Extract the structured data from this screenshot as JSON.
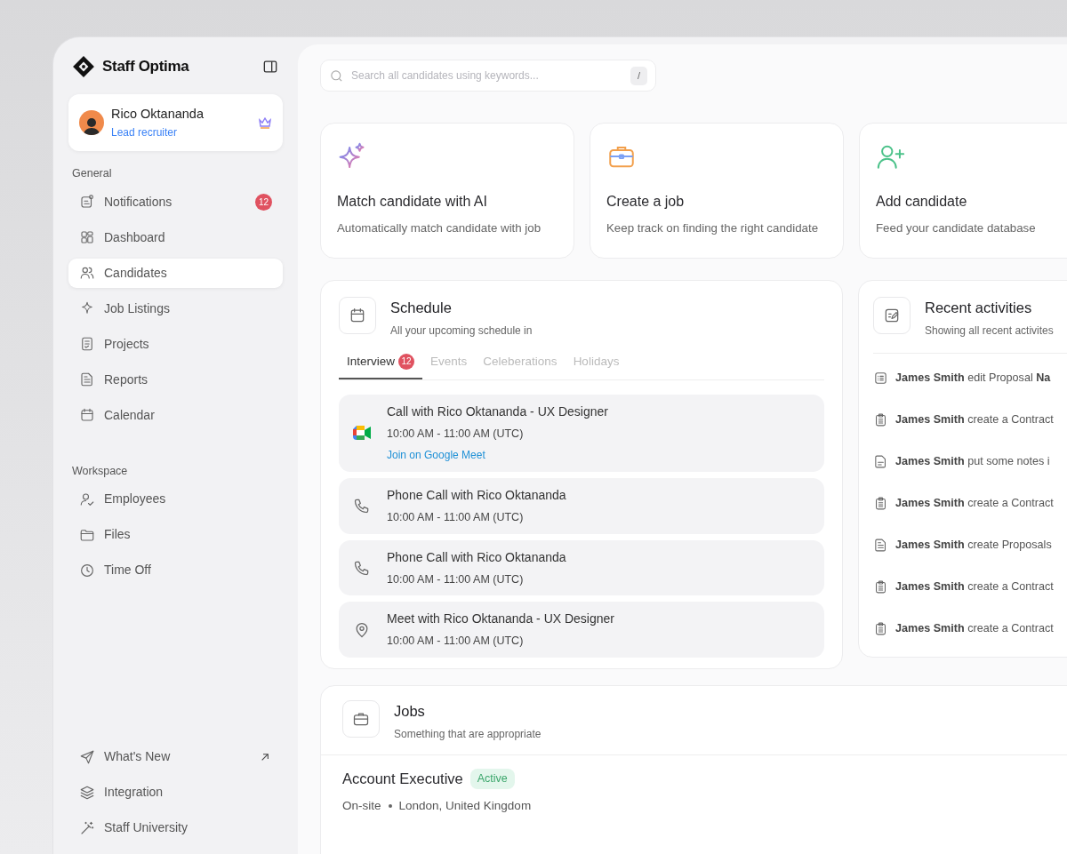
{
  "app": {
    "name": "Staff Optima"
  },
  "user": {
    "name": "Rico Oktananda",
    "role": "Lead recruiter"
  },
  "sidebar": {
    "sections": [
      {
        "title": "General",
        "items": [
          {
            "label": "Notifications",
            "kind": "notification",
            "badge": "12",
            "selected": false
          },
          {
            "label": "Dashboard",
            "kind": "grid",
            "selected": false
          },
          {
            "label": "Candidates",
            "kind": "users",
            "selected": true
          },
          {
            "label": "Job Listings",
            "kind": "sparkle",
            "selected": false
          },
          {
            "label": "Projects",
            "kind": "checklist",
            "selected": false
          },
          {
            "label": "Reports",
            "kind": "document",
            "selected": false
          },
          {
            "label": "Calendar",
            "kind": "calendar",
            "selected": false
          }
        ]
      },
      {
        "title": "Workspace",
        "items": [
          {
            "label": "Employees",
            "kind": "user-check",
            "selected": false
          },
          {
            "label": "Files",
            "kind": "folder",
            "selected": false
          },
          {
            "label": "Time Off",
            "kind": "clock",
            "selected": false
          }
        ]
      }
    ],
    "footer_items": [
      {
        "label": "What's New",
        "kind": "send",
        "external": true
      },
      {
        "label": "Integration",
        "kind": "layers",
        "external": false
      },
      {
        "label": "Staff University",
        "kind": "wand",
        "external": false
      }
    ]
  },
  "search": {
    "placeholder": "Search all candidates using keywords...",
    "shortcut": "/"
  },
  "quick_actions": [
    {
      "kind": "ai",
      "title": "Match candidate with AI",
      "description": "Automatically match candidate with job"
    },
    {
      "kind": "briefcase",
      "title": "Create a job",
      "description": "Keep track on finding the right candidate"
    },
    {
      "kind": "user-plus",
      "title": "Add candidate",
      "description": "Feed your candidate database"
    }
  ],
  "schedule": {
    "title": "Schedule",
    "subtitle": "All your upcoming schedule in",
    "tabs": [
      {
        "label": "Interview",
        "badge": "12",
        "selected": true
      },
      {
        "label": "Events",
        "selected": false
      },
      {
        "label": "Celeberations",
        "selected": false
      },
      {
        "label": "Holidays",
        "selected": false
      }
    ],
    "events": [
      {
        "kind": "video",
        "title": "Call with Rico Oktananda - UX Designer",
        "time": "10:00 AM - 11:00 AM (UTC)",
        "link": "Join on Google Meet"
      },
      {
        "kind": "phone",
        "title": "Phone Call with Rico Oktananda",
        "time": "10:00 AM - 11:00 AM (UTC)"
      },
      {
        "kind": "phone",
        "title": "Phone Call with Rico Oktananda",
        "time": "10:00 AM - 11:00 AM (UTC)"
      },
      {
        "kind": "location",
        "title": "Meet with Rico Oktananda - UX Designer",
        "time": "10:00 AM - 11:00 AM (UTC)"
      }
    ]
  },
  "activities": {
    "title": "Recent activities",
    "subtitle": "Showing all recent activites",
    "items": [
      {
        "kind": "list",
        "text": "**James Smith** edit Proposal **Na**"
      },
      {
        "kind": "clipboard",
        "text": "**James Smith** create a Contract"
      },
      {
        "kind": "note",
        "text": "**James Smith** put some notes i"
      },
      {
        "kind": "clipboard",
        "text": "**James Smith** create a Contract"
      },
      {
        "kind": "document",
        "text": "**James Smith** create Proposals"
      },
      {
        "kind": "clipboard",
        "text": "**James Smith** create a Contract"
      },
      {
        "kind": "clipboard",
        "text": "**James Smith** create a Contract"
      }
    ]
  },
  "jobs": {
    "title": "Jobs",
    "subtitle": "Something that are appropriate",
    "items": [
      {
        "title": "Account Executive",
        "status": "Active",
        "active": true,
        "work_type": "On-site",
        "location": "London, United Kingdom"
      }
    ]
  }
}
